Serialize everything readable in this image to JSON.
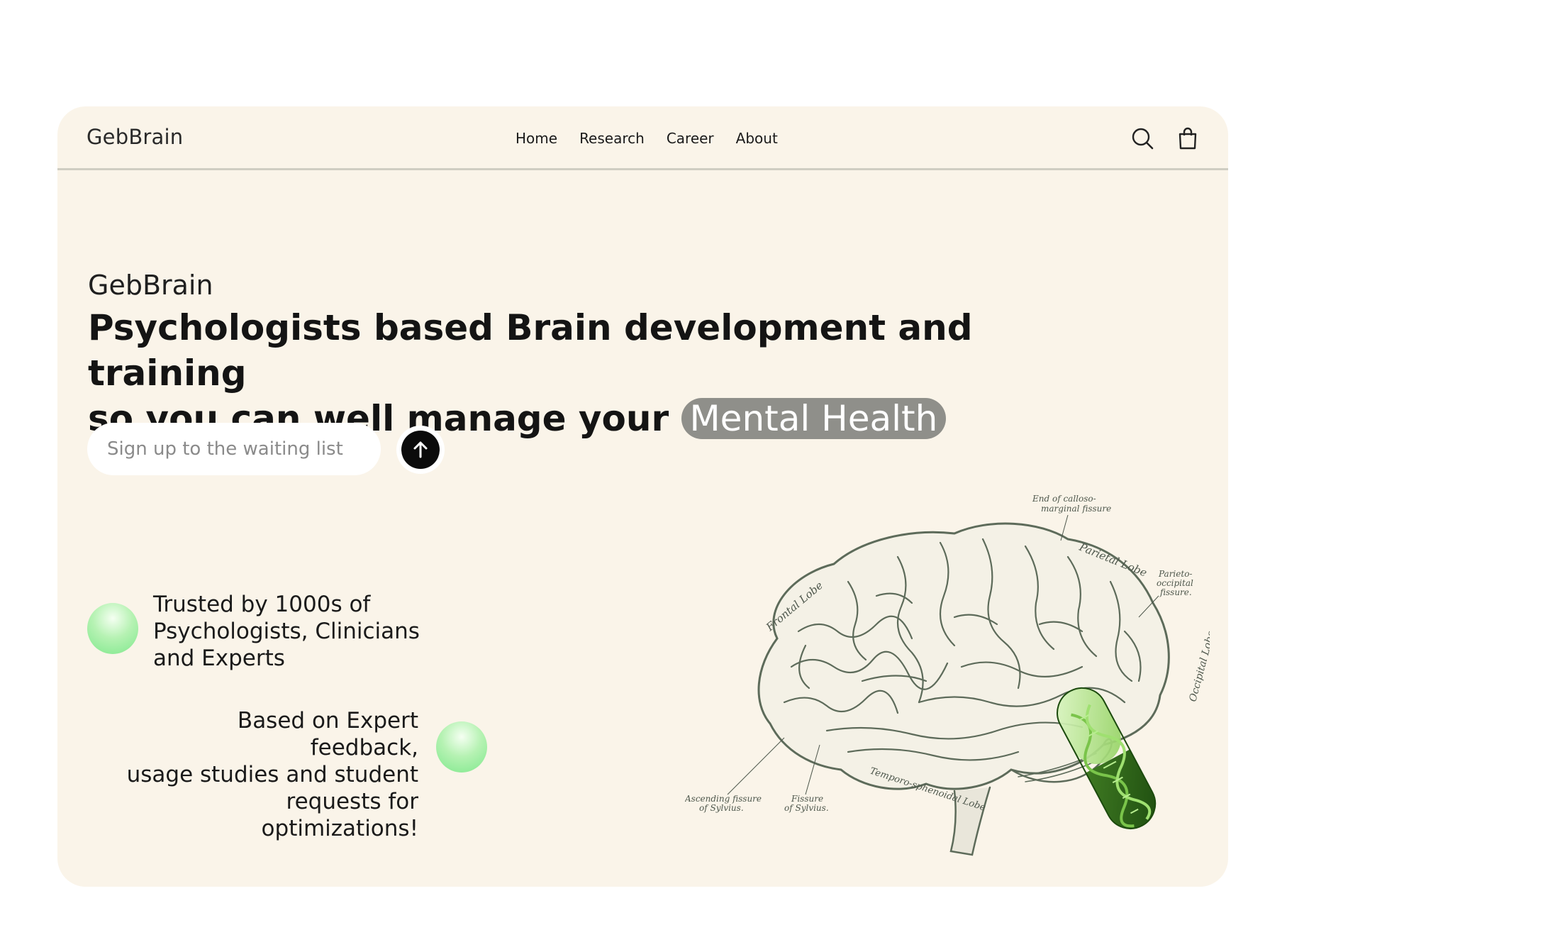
{
  "header": {
    "logo": "GebBrain",
    "nav": [
      "Home",
      "Research",
      "Career",
      "About"
    ],
    "icons": [
      "search-icon",
      "shopping-bag-icon"
    ]
  },
  "hero": {
    "brand": "GebBrain",
    "headline_line1": "Psychologists based Brain development and training",
    "headline_line2": "so you can well manage your",
    "headline_highlight": "Mental Health",
    "signup_placeholder": "Sign up to the waiting list",
    "submit_icon": "arrow-up-icon"
  },
  "features": {
    "trust_text": [
      "Trusted by 1000s of",
      "Psychologists, Clinicians",
      "and Experts"
    ],
    "expert_text": [
      "Based on Expert feedback,",
      "usage studies and student",
      "requests for optimizations!"
    ]
  },
  "brain_labels": {
    "top": [
      "End of calloso-",
      "marginal fissure"
    ],
    "parietal": "Parietal Lobe",
    "parieto": [
      "Parieto-",
      "occipital",
      "fissure."
    ],
    "frontal": "Frontal Lobe",
    "occipital": "Occipital Lobe",
    "ascending": [
      "Ascending fissure",
      "of Sylvius."
    ],
    "fissure": [
      "Fissure",
      "of Sylvius."
    ],
    "temporo": "Temporo-sphenoidal Lobe"
  },
  "colors": {
    "card_bg": "#faf4e9",
    "highlight_bg": "#8f8f8a",
    "accent_green": "#7ee88c",
    "brain_ink": "#5d6b5a"
  }
}
